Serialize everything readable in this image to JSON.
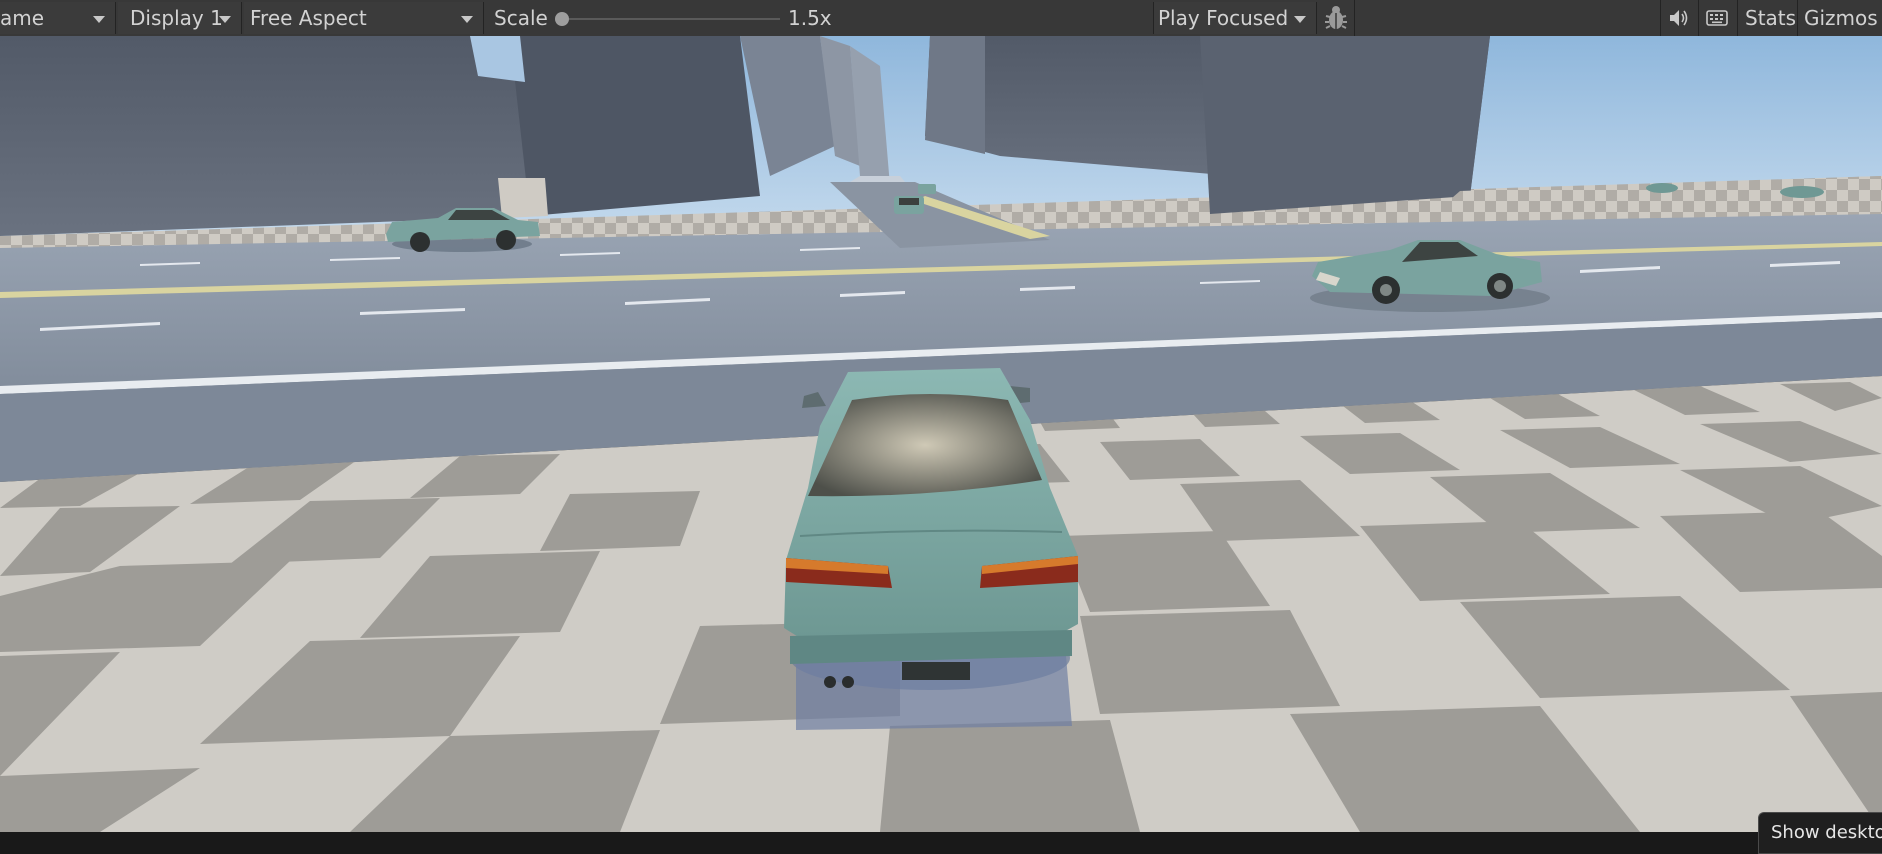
{
  "toolbar": {
    "game_tab_label": "ame",
    "display_label": "Display 1",
    "aspect_label": "Free Aspect",
    "scale_label": "Scale",
    "scale_value": "1.5x",
    "scale_fraction": 0.0,
    "play_mode_label": "Play Focused",
    "stats_label": "Stats",
    "gizmos_label": "Gizmos",
    "icons": [
      "bug-icon",
      "speaker-icon",
      "keyboard-icon"
    ]
  },
  "viewport": {
    "scene": "game-view-render",
    "colors": {
      "sky_top": "#8fb7dc",
      "sky_bottom": "#d4e4f2",
      "building": "#5c6472",
      "road": "#8e99a8",
      "checker_light": "#d3d0ca",
      "checker_dark": "#9c9a95",
      "car_body": "#7eaaa5"
    }
  },
  "tooltip": {
    "text": "Show desktop"
  }
}
